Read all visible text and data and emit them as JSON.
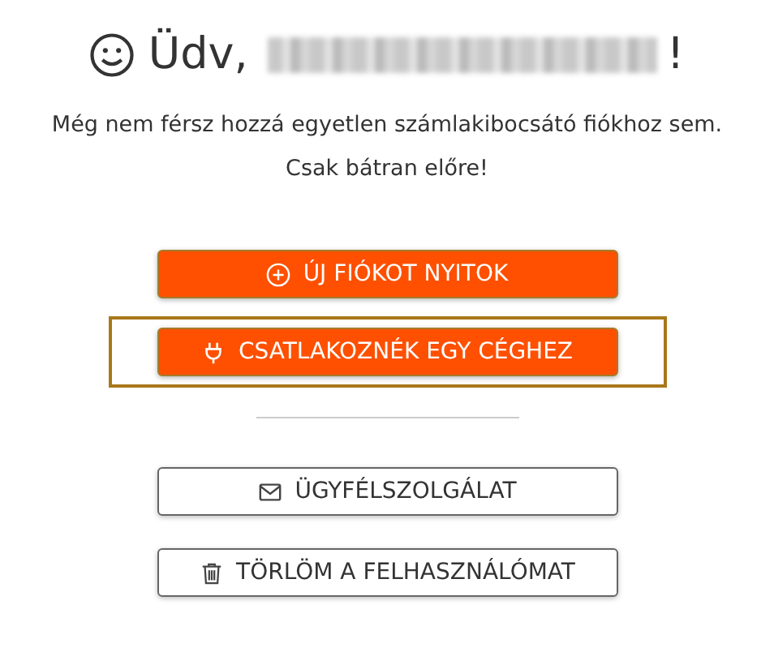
{
  "heading": {
    "greeting": "Üdv,",
    "end": "!"
  },
  "message": [
    "Még nem férsz hozzá egyetlen számlakibocsátó fiókhoz sem.",
    "Csak bátran előre!"
  ],
  "primary_buttons": [
    {
      "label": "ÚJ FIÓKOT NYITOK",
      "focused": false
    },
    {
      "label": "CSATLAKOZNÉK EGY CÉGHEZ",
      "focused": true
    }
  ],
  "secondary_buttons": [
    {
      "label": "ÜGYFÉLSZOLGÁLAT"
    },
    {
      "label": "TÖRLÖM A FELHASZNÁLÓMAT"
    }
  ]
}
